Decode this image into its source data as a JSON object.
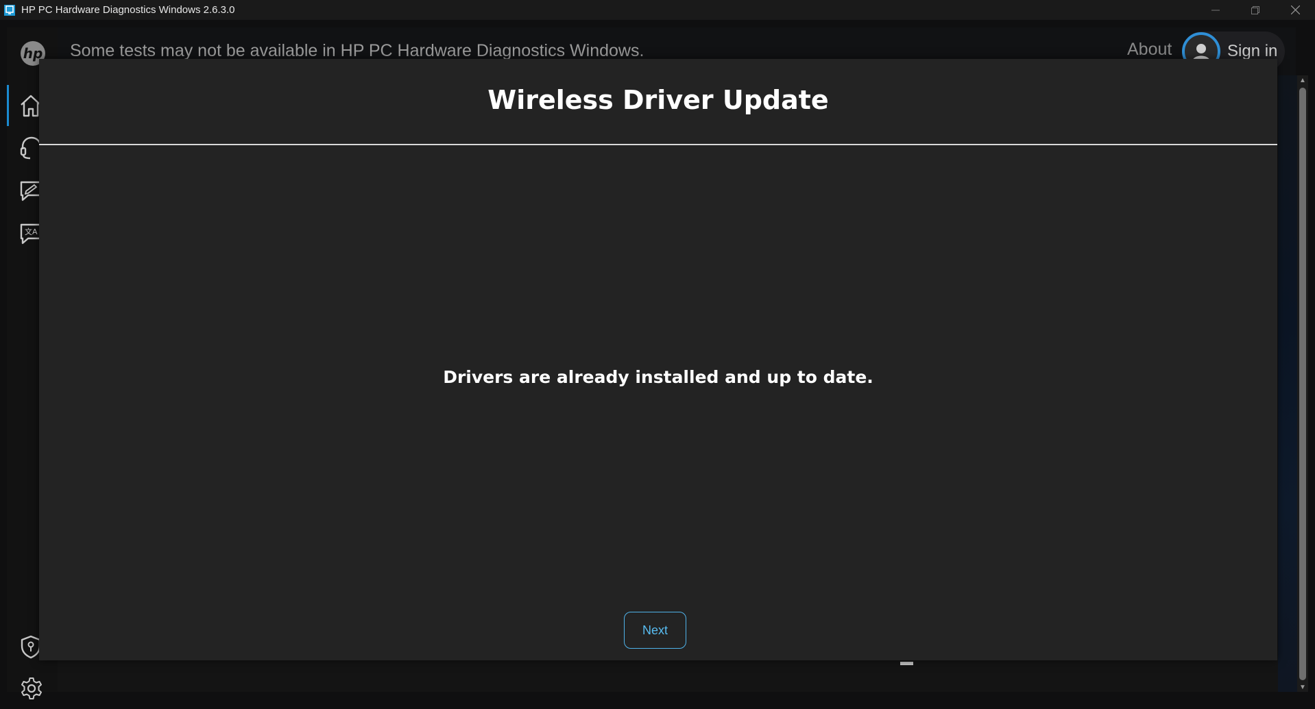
{
  "window": {
    "title": "HP PC Hardware Diagnostics Windows 2.6.3.0",
    "controls": [
      "minimize",
      "restore",
      "close"
    ]
  },
  "header": {
    "notice": "Some tests may not be available in HP PC Hardware Diagnostics Windows.",
    "about_label": "About",
    "signin_label": "Sign in"
  },
  "sidebar": {
    "items": [
      {
        "name": "home",
        "icon": "home-icon",
        "active": true
      },
      {
        "name": "support",
        "icon": "headset-icon",
        "active": false
      },
      {
        "name": "feedback",
        "icon": "feedback-icon",
        "active": false
      },
      {
        "name": "language",
        "icon": "language-icon",
        "active": false
      },
      {
        "name": "security",
        "icon": "shield-key-icon",
        "active": false
      },
      {
        "name": "settings",
        "icon": "gear-icon",
        "active": false
      }
    ]
  },
  "modal": {
    "title": "Wireless Driver Update",
    "message": "Drivers are already installed and up to date.",
    "next_label": "Next"
  },
  "colors": {
    "accent": "#1b8bd1",
    "button_text": "#58bdf2",
    "modal_bg": "#232323"
  }
}
